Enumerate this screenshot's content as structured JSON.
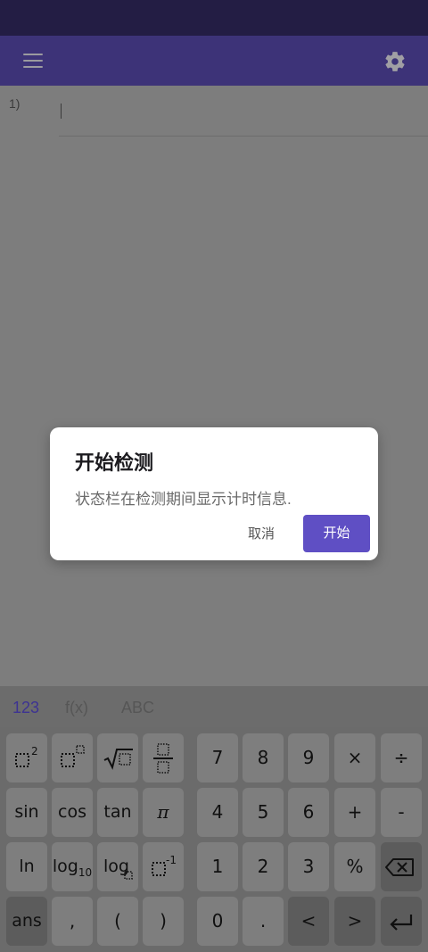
{
  "header": {
    "menu_icon": "menu-icon",
    "settings_icon": "gear-icon"
  },
  "editor": {
    "row_label": "1)"
  },
  "dialog": {
    "title": "开始检测",
    "message": "状态栏在检测期间显示计时信息.",
    "cancel": "取消",
    "start": "开始",
    "accent": "#5f4fc4"
  },
  "keyboard_tabs": {
    "numbers": "123",
    "functions": "f(x)",
    "letters": "ABC"
  },
  "keys": {
    "x_squared": "x²",
    "x_power": "xⁿ",
    "nth_root": "ⁿ√",
    "fraction": "fraction",
    "seven": "7",
    "eight": "8",
    "nine": "9",
    "times": "×",
    "divide": "÷",
    "sin": "sin",
    "cos": "cos",
    "tan": "tan",
    "pi": "π",
    "four": "4",
    "five": "5",
    "six": "6",
    "plus": "+",
    "minus": "-",
    "ln": "ln",
    "log10": "log",
    "log10_sub": "10",
    "logn": "log",
    "inverse": "x⁻¹",
    "one": "1",
    "two": "2",
    "three": "3",
    "percent": "%",
    "backspace": "backspace-icon",
    "ans": "ans",
    "comma": ",",
    "lparen": "(",
    "rparen": ")",
    "zero": "0",
    "dot": ".",
    "left": "<",
    "right": ">",
    "enter": "enter-icon"
  }
}
